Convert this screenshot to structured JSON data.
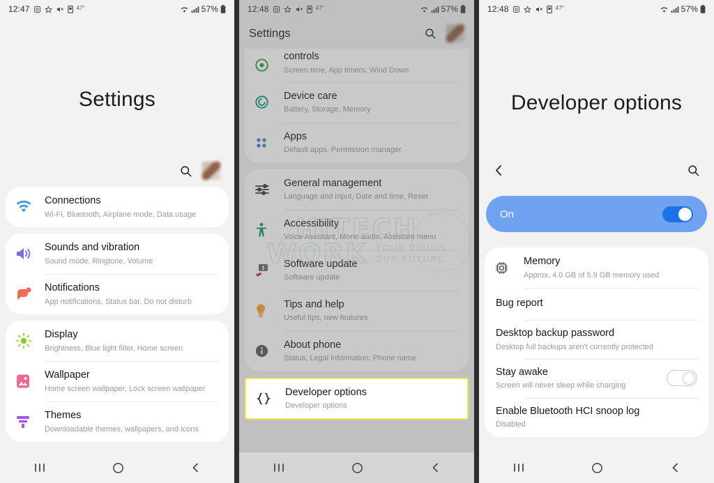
{
  "panels": [
    {
      "id": "settings-home",
      "statusbar": {
        "time": "12:47",
        "temp": "47°",
        "battery": "57%",
        "icons": [
          "screenshot-icon",
          "star-icon",
          "mute-icon",
          "sim-icon",
          "wifi-icon",
          "signal-icon",
          "battery-icon"
        ]
      },
      "title": "Settings",
      "actions": {
        "search": "search-icon",
        "avatar": "avatar"
      },
      "groups": [
        {
          "rows": [
            {
              "icon": "wifi-icon",
              "color": "#4a9bdc",
              "title": "Connections",
              "sub": "Wi-Fi, Bluetooth, Airplane mode, Data usage"
            }
          ]
        },
        {
          "rows": [
            {
              "icon": "speaker-icon",
              "color": "#7c6fe0",
              "title": "Sounds and vibration",
              "sub": "Sound mode, Ringtone, Volume"
            },
            {
              "icon": "notification-icon",
              "color": "#ef6b5a",
              "title": "Notifications",
              "sub": "App notifications, Status bar, Do not disturb"
            }
          ]
        },
        {
          "rows": [
            {
              "icon": "brightness-icon",
              "color": "#8bcb2a",
              "title": "Display",
              "sub": "Brightness, Blue light filter, Home screen"
            },
            {
              "icon": "wallpaper-icon",
              "color": "#ec6a92",
              "title": "Wallpaper",
              "sub": "Home screen wallpaper, Lock screen wallpaper"
            },
            {
              "icon": "themes-icon",
              "color": "#a259e6",
              "title": "Themes",
              "sub": "Downloadable themes, wallpapers, and icons"
            }
          ]
        }
      ],
      "navbar": [
        "recents-icon",
        "home-icon",
        "back-icon"
      ]
    },
    {
      "id": "settings-scrolled",
      "statusbar": {
        "time": "12:48",
        "temp": "47°",
        "battery": "57%"
      },
      "appbar_title": "Settings",
      "groups": [
        {
          "rows": [
            {
              "icon": "wellbeing-icon",
              "color": "#2f9e44",
              "title": "controls",
              "sub": "Screen time, App timers, Wind Down",
              "clipped": true
            },
            {
              "icon": "devicecare-icon",
              "color": "#0f9b7e",
              "title": "Device care",
              "sub": "Battery, Storage, Memory"
            },
            {
              "icon": "apps-icon",
              "color": "#4a7fd6",
              "title": "Apps",
              "sub": "Default apps, Permission manager"
            }
          ]
        },
        {
          "rows": [
            {
              "icon": "sliders-icon",
              "color": "#3a3a3a",
              "title": "General management",
              "sub": "Language and input, Date and time, Reset"
            },
            {
              "icon": "accessibility-icon",
              "color": "#17916b",
              "title": "Accessibility",
              "sub": "Voice Assistant, Mono audio, Assistant menu"
            },
            {
              "icon": "software-update-icon",
              "color": "#5a5a5a",
              "title": "Software update",
              "sub": "Software update"
            },
            {
              "icon": "tips-icon",
              "color": "#f0a330",
              "title": "Tips and help",
              "sub": "Useful tips, new features"
            },
            {
              "icon": "info-icon",
              "color": "#5a5a5a",
              "title": "About phone",
              "sub": "Status, Legal information, Phone name"
            },
            {
              "icon": "braces-icon",
              "color": "#3a3a3a",
              "title": "Developer options",
              "sub": "Developer options",
              "highlight": true
            }
          ]
        }
      ],
      "highlight_color": "#f2e94b",
      "navbar": [
        "recents-icon",
        "home-icon",
        "back-icon"
      ]
    },
    {
      "id": "developer-options",
      "statusbar": {
        "time": "12:48",
        "temp": "47°",
        "battery": "57%"
      },
      "title": "Developer options",
      "actions": {
        "back": "back-chevron-icon",
        "search": "search-icon"
      },
      "master_toggle": {
        "label": "On",
        "state": "on",
        "bar_color": "#6fa2f0",
        "switch_color": "#1a73e8"
      },
      "groups": [
        {
          "rows": [
            {
              "icon": "memory-chip-icon",
              "color": "#5a5a5a",
              "title": "Memory",
              "sub": "Approx. 4.0 GB of 5.9 GB memory used"
            },
            {
              "title": "Bug report",
              "sub": ""
            },
            {
              "title": "Desktop backup password",
              "sub": "Desktop full backups aren't currently protected"
            },
            {
              "title": "Stay awake",
              "sub": "Screen will never sleep while charging",
              "toggle": "off"
            },
            {
              "title": "Enable Bluetooth HCI snoop log",
              "sub": "Disabled"
            }
          ]
        }
      ],
      "navbar": [
        "recents-icon",
        "home-icon",
        "back-icon"
      ]
    }
  ],
  "watermark": {
    "line1": "HITECH",
    "line2": "WORK",
    "tagline_top": "YOUR VISION",
    "tagline_bottom": "OUR FUTURE"
  }
}
